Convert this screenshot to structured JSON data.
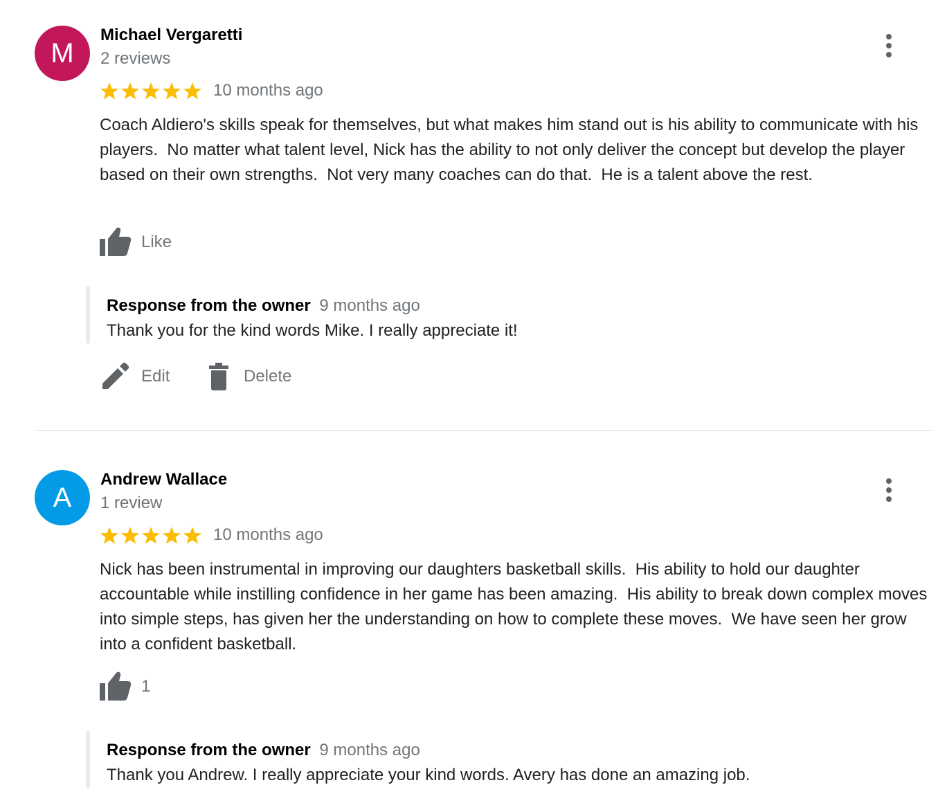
{
  "colors": {
    "star": "#fbbc04",
    "secondary_text": "#70757a",
    "icon_gray": "#5f6368"
  },
  "reviews": [
    {
      "avatar_letter": "M",
      "avatar_color": "#c2185b",
      "name": "Michael Vergaretti",
      "review_count": "2 reviews",
      "rating": 5,
      "time": "10 months ago",
      "text": "Coach Aldiero's skills speak for themselves, but what makes him stand out is his ability to communicate with his players.  No matter what talent level, Nick has the ability to not only deliver the concept but develop the player based on their own strengths.  Not very many coaches can do that.  He is a talent above the rest.",
      "like_label": "Like",
      "response": {
        "title": "Response from the owner",
        "time": "9 months ago",
        "text": "Thank you for the kind words Mike. I really appreciate it!"
      },
      "actions": {
        "edit": "Edit",
        "delete": "Delete"
      }
    },
    {
      "avatar_letter": "A",
      "avatar_color": "#039be5",
      "name": "Andrew Wallace",
      "review_count": "1 review",
      "rating": 5,
      "time": "10 months ago",
      "text": "Nick has been instrumental in improving our daughters basketball skills.  His ability to hold our daughter accountable while instilling confidence in her game has been amazing.  His ability to break down complex moves into simple steps, has given her the understanding on how to complete these moves.  We have seen her grow into a confident basketball.",
      "like_label": "1",
      "response": {
        "title": "Response from the owner",
        "time": "9 months ago",
        "text": "Thank you Andrew. I really appreciate your kind words. Avery has done an amazing job."
      }
    }
  ]
}
